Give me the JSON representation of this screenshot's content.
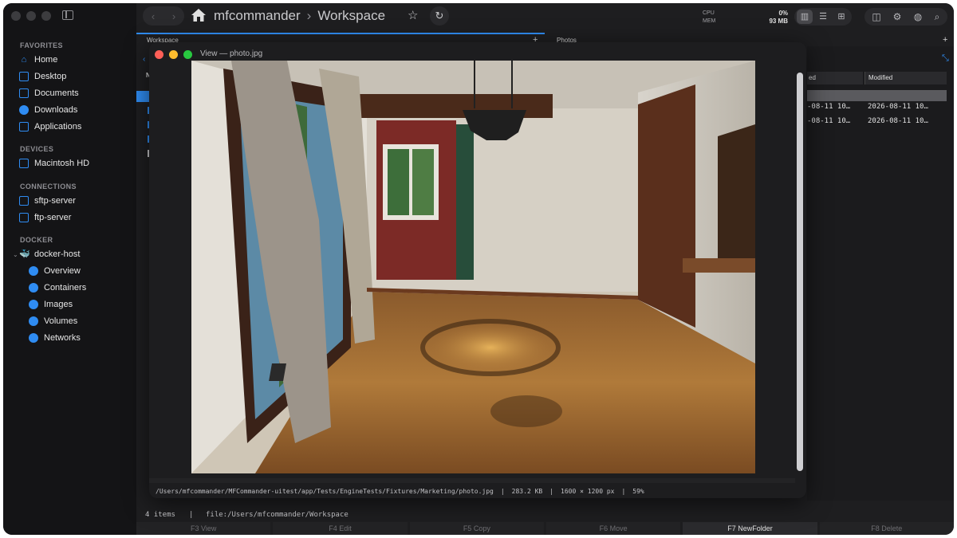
{
  "app": {
    "path_root": "mfcommander",
    "path_sep": "›",
    "path_current": "Workspace"
  },
  "sidebar": {
    "favorites_title": "FAVORITES",
    "favorites": [
      {
        "label": "Home",
        "icon": "home-icon"
      },
      {
        "label": "Desktop",
        "icon": "desktop-icon"
      },
      {
        "label": "Documents",
        "icon": "documents-icon"
      },
      {
        "label": "Downloads",
        "icon": "downloads-icon"
      },
      {
        "label": "Applications",
        "icon": "applications-icon"
      }
    ],
    "devices_title": "DEVICES",
    "devices": [
      {
        "label": "Macintosh HD",
        "icon": "drive-icon"
      }
    ],
    "connections_title": "CONNECTIONS",
    "connections": [
      {
        "label": "sftp-server",
        "icon": "server-icon"
      },
      {
        "label": "ftp-server",
        "icon": "server-icon"
      }
    ],
    "docker_title": "DOCKER",
    "docker_host": "docker-host",
    "docker_items": [
      {
        "label": "Overview",
        "icon": "overview-icon"
      },
      {
        "label": "Containers",
        "icon": "containers-icon"
      },
      {
        "label": "Images",
        "icon": "images-icon"
      },
      {
        "label": "Volumes",
        "icon": "volumes-icon"
      },
      {
        "label": "Networks",
        "icon": "networks-icon"
      }
    ]
  },
  "stats": {
    "cpu_label": "CPU",
    "mem_label": "MEM",
    "cpu_value": "0%",
    "mem_value": "93 MB"
  },
  "panes": {
    "left_tab": "Workspace",
    "right_tab": "Photos",
    "left_header": "N",
    "right_col_created": "ed",
    "right_col_modified": "Modified",
    "rows": [
      {
        "created": "-08-11 10…",
        "modified": "2026-08-11 10…"
      },
      {
        "created": "-08-11 10…",
        "modified": "2026-08-11 10…"
      }
    ]
  },
  "viewer": {
    "title": "View — photo.jpg",
    "path": "/Users/mfcommander/MFCommander-uitest/app/Tests/EngineTests/Fixtures/Marketing/photo.jpg",
    "sep": "|",
    "size": "283.2 KB",
    "dimensions": "1600 × 1200 px",
    "zoom": "59%"
  },
  "status": {
    "items": "4 items",
    "sep": "|",
    "location": "file:/Users/mfcommander/Workspace"
  },
  "fkeys": [
    "F3 View",
    "F4 Edit",
    "F5 Copy",
    "F6 Move",
    "F7 NewFolder",
    "F8 Delete"
  ],
  "colors": {
    "accent": "#2f8cf2",
    "close": "#ff5f57",
    "minimize": "#febc2e",
    "zoom": "#28c840"
  }
}
